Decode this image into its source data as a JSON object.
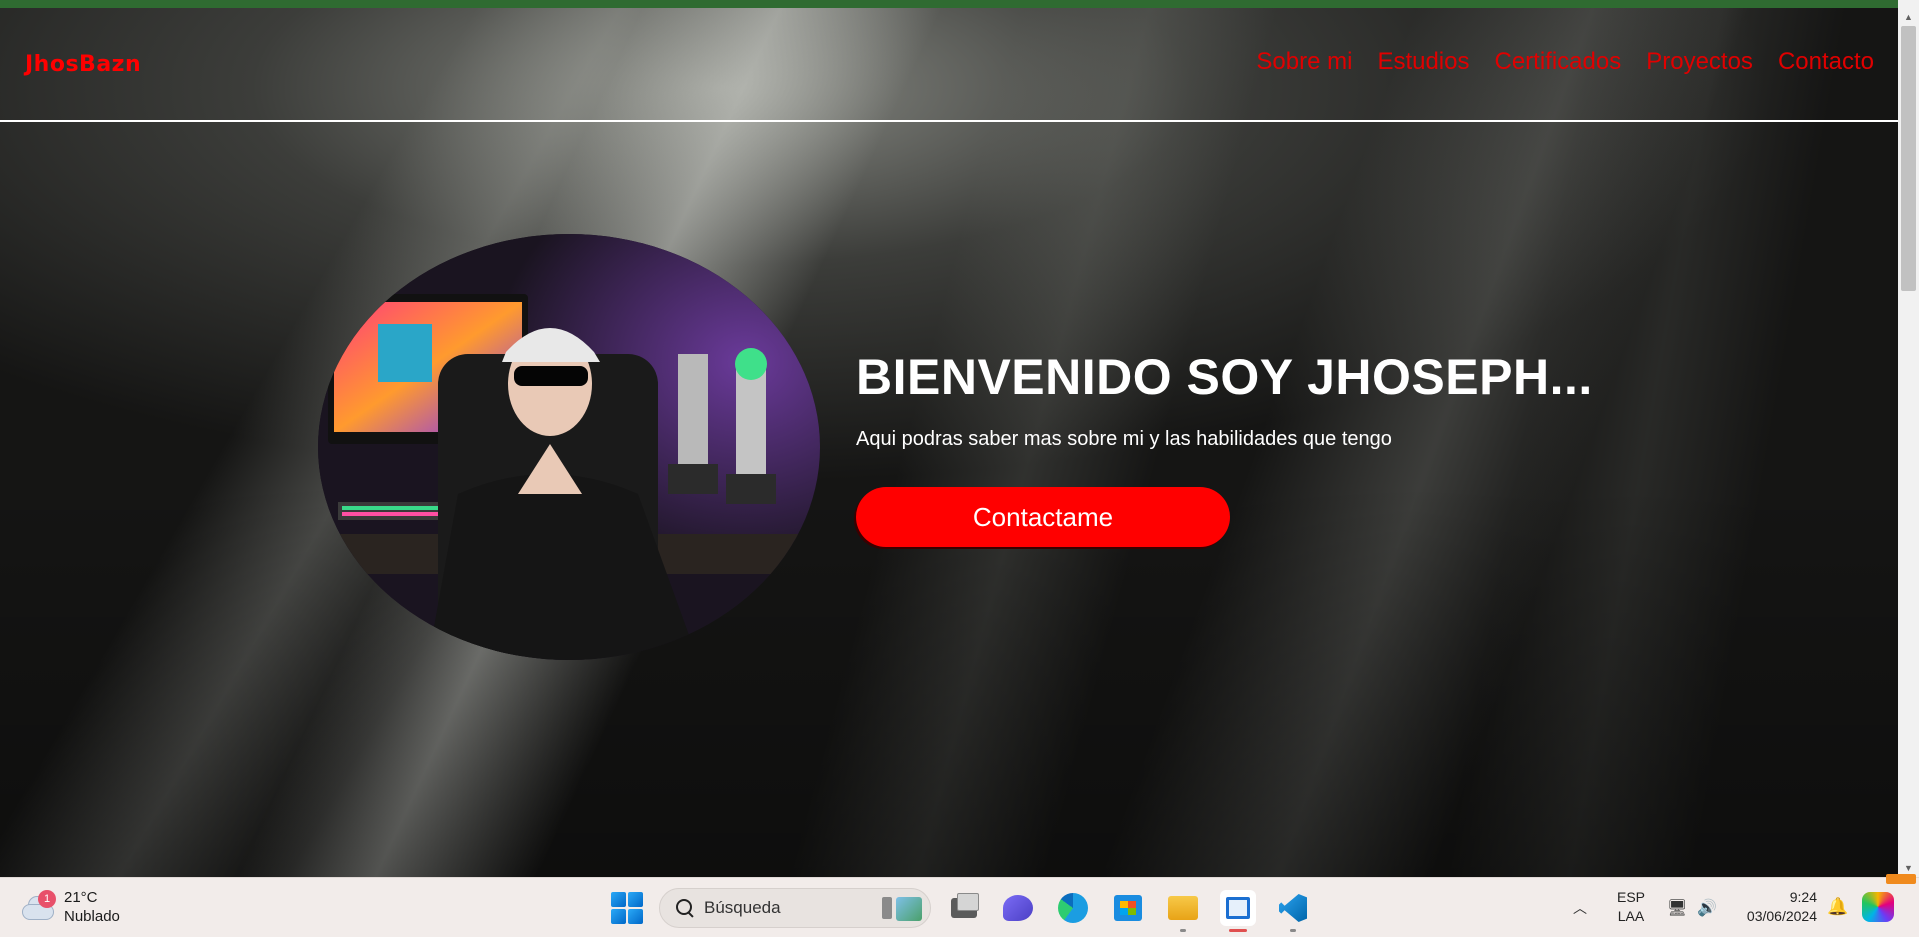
{
  "site": {
    "logo": "JhosBazn",
    "nav": [
      {
        "label": "Sobre mi"
      },
      {
        "label": "Estudios"
      },
      {
        "label": "Certificados"
      },
      {
        "label": "Proyectos"
      },
      {
        "label": "Contacto"
      }
    ],
    "hero": {
      "title": "BIENVENIDO SOY JHOSEPH...",
      "subtitle": "Aqui podras saber mas sobre mi y las habilidades que tengo",
      "button_label": "Contactame",
      "photo_icon": "profile-photo"
    },
    "colors": {
      "accent": "#ff0000",
      "top_strip": "#2f6b31",
      "text": "#ffffff"
    }
  },
  "taskbar": {
    "weather": {
      "temperature": "21°C",
      "condition": "Nublado",
      "badge": "1",
      "icon": "cloud-icon"
    },
    "search": {
      "placeholder": "Búsqueda"
    },
    "apps": [
      {
        "name": "start",
        "icon": "windows-icon"
      },
      {
        "name": "task-view",
        "icon": "task-view-icon"
      },
      {
        "name": "meet",
        "icon": "meet-icon"
      },
      {
        "name": "edge",
        "icon": "edge-icon"
      },
      {
        "name": "store",
        "icon": "store-icon"
      },
      {
        "name": "file-explorer",
        "icon": "folder-icon"
      },
      {
        "name": "active-app",
        "icon": "app-window-icon"
      },
      {
        "name": "vscode",
        "icon": "vscode-icon"
      }
    ],
    "tray": {
      "lang_line1": "ESP",
      "lang_line2": "LAA",
      "time": "9:24",
      "date": "03/06/2024"
    }
  }
}
